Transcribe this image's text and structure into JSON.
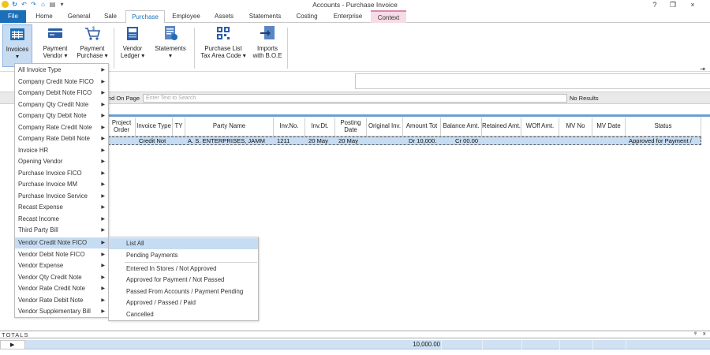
{
  "window": {
    "title": "Accounts - Purchase Invoice"
  },
  "tabs": [
    {
      "label": "File"
    },
    {
      "label": "Home"
    },
    {
      "label": "General"
    },
    {
      "label": "Sale"
    },
    {
      "label": "Purchase"
    },
    {
      "label": "Employee"
    },
    {
      "label": "Assets"
    },
    {
      "label": "Statements"
    },
    {
      "label": "Costing"
    },
    {
      "label": "Enterprise"
    },
    {
      "label": "Context"
    }
  ],
  "ribbon": {
    "invoices": "Invoices",
    "payment_vendor_1": "Payment",
    "payment_vendor_2": "Vendor",
    "payment_purchase_1": "Payment",
    "payment_purchase_2": "Purchase",
    "vendor_ledger_1": "Vendor",
    "vendor_ledger_2": "Ledger",
    "statements": "Statements",
    "purchase_list_1": "Purchase List",
    "purchase_list_2": "Tax Area Code",
    "imports_1": "Imports",
    "imports_2": "with B.O.E"
  },
  "find": {
    "label": "nd On Page",
    "placeholder": "Enter Text to Search",
    "result": "No Results"
  },
  "grid": {
    "headers": [
      "Project Order",
      "Invoice Type",
      "TY",
      "Party Name",
      "Inv.No.",
      "Inv.Dt.",
      "Posting Date",
      "Original Inv.",
      "Amount Tot",
      "Balance Amt.",
      "Retained Amt.",
      "WOff Amt.",
      "MV No",
      "MV Date",
      "Status"
    ],
    "row": {
      "invoice_type": "Credit Not",
      "party_name": "A. S. ENTERPRISES, JAMM",
      "inv_no": "1211",
      "inv_dt": "20 May",
      "posting_date": "20 May",
      "amount_tot": "Dr 10,000.",
      "balance_amt": "Cr 00.00",
      "status": "Approved for Payment /"
    }
  },
  "menu": {
    "items": [
      "All Invoice Type",
      "Company Credit Note FICO",
      "Company Debit Note FICO",
      "Company Qty Credit Note",
      "Company Qty Debit Note",
      "Company Rate Credit Note",
      "Company Rate Debit Note",
      "Invoice HR",
      "Opening Vendor",
      "Purchase Invoice FICO",
      "Purchase Invoice MM",
      "Purchase Invoice Service",
      "Recast Expense",
      "Recast Income",
      "Third Party Bill",
      "Vendor Credit Note FICO",
      "Vendor Debit Note FICO",
      "Vendor Expense",
      "Vendor Qty Credit Note",
      "Vendor Rate Credit Note",
      "Vendor Rate Debit Note",
      "Vendor Supplementary Bill"
    ],
    "arrow": "▶"
  },
  "submenu": {
    "items": [
      "List All",
      "Pending Payments",
      "Entered In Stores / Not Approved",
      "Approved for Payment / Not Passed",
      "Passed From Accounts / Payment Pending",
      "Approved / Passed / Paid",
      "Cancelled"
    ]
  },
  "totals": {
    "label": "TOTALS",
    "value": "10,000.00",
    "pin": "ᵠ",
    "close": "x",
    "row_arrow": "▶"
  },
  "icons": {
    "help": "?",
    "restore": "❐",
    "close": "×",
    "pin": "⇥"
  }
}
